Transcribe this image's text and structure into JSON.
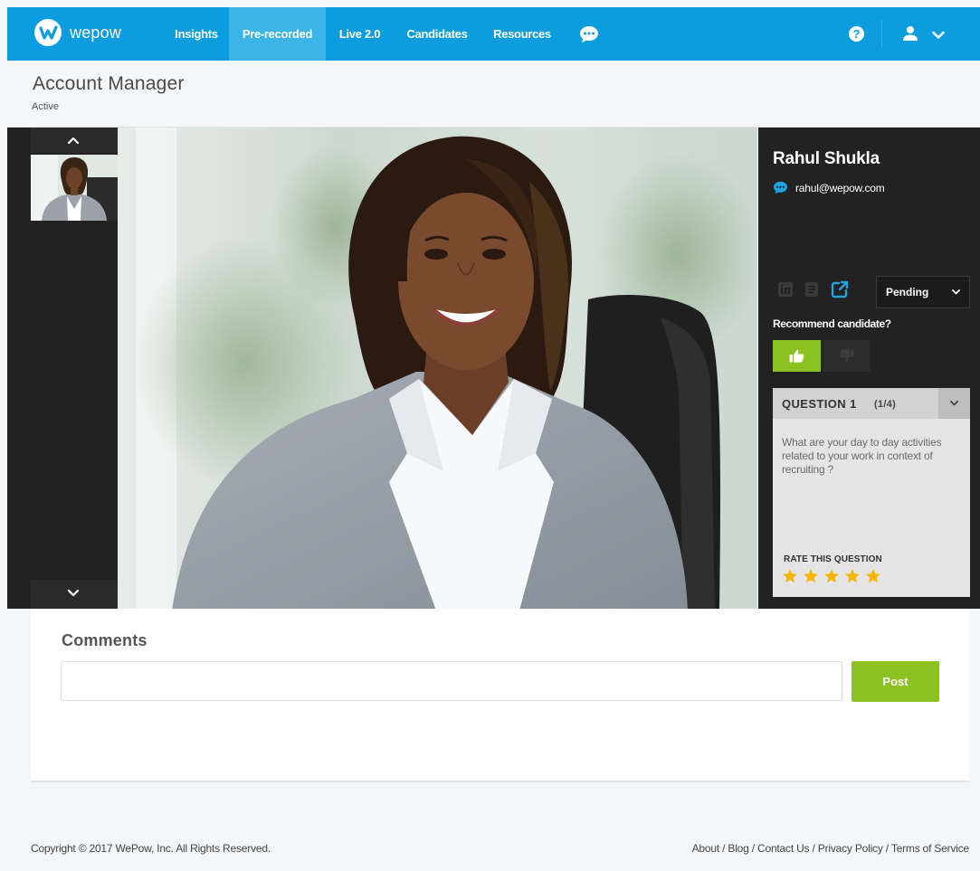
{
  "app": {
    "brand": "wepow"
  },
  "nav": {
    "items": [
      {
        "label": "Insights"
      },
      {
        "label": "Pre-recorded"
      },
      {
        "label": "Live 2.0"
      },
      {
        "label": "Candidates"
      },
      {
        "label": "Resources"
      }
    ],
    "active": "Pre-recorded",
    "help_label": "?"
  },
  "page": {
    "title": "Account Manager",
    "status": "Active"
  },
  "candidate": {
    "name": "Rahul Shukla",
    "email": "rahul@wepow.com",
    "status_selected": "Pending",
    "recommend_label": "Recommend candidate?"
  },
  "question": {
    "title": "QUESTION 1",
    "count": "(1/4)",
    "text": "What are your day to day activities related to your work in context of recruiting ?",
    "rate_label": "RATE THIS QUESTION",
    "rating": 5,
    "rating_max": 5
  },
  "comments": {
    "label": "Comments",
    "input_value": "",
    "input_placeholder": "",
    "post_label": "Post"
  },
  "footer": {
    "copyright": "Copyright © 2017 WePow, Inc. All Rights Reserved.",
    "links": "About / Blog / Contact Us / Privacy Policy / Terms of Service"
  },
  "colors": {
    "brand_blue": "#0c9ddf",
    "active_tab": "#3cb4e8",
    "accent_green": "#8cc21f",
    "star_gold": "#f2b705",
    "panel_dark": "#222222"
  },
  "icons": [
    "logo-icon",
    "chat-icon",
    "help-icon",
    "user-icon",
    "chevron-down-icon",
    "chevron-up-icon",
    "linkedin-icon",
    "resume-icon",
    "external-link-icon",
    "thumbs-up-icon",
    "thumbs-down-icon",
    "star-icon"
  ]
}
